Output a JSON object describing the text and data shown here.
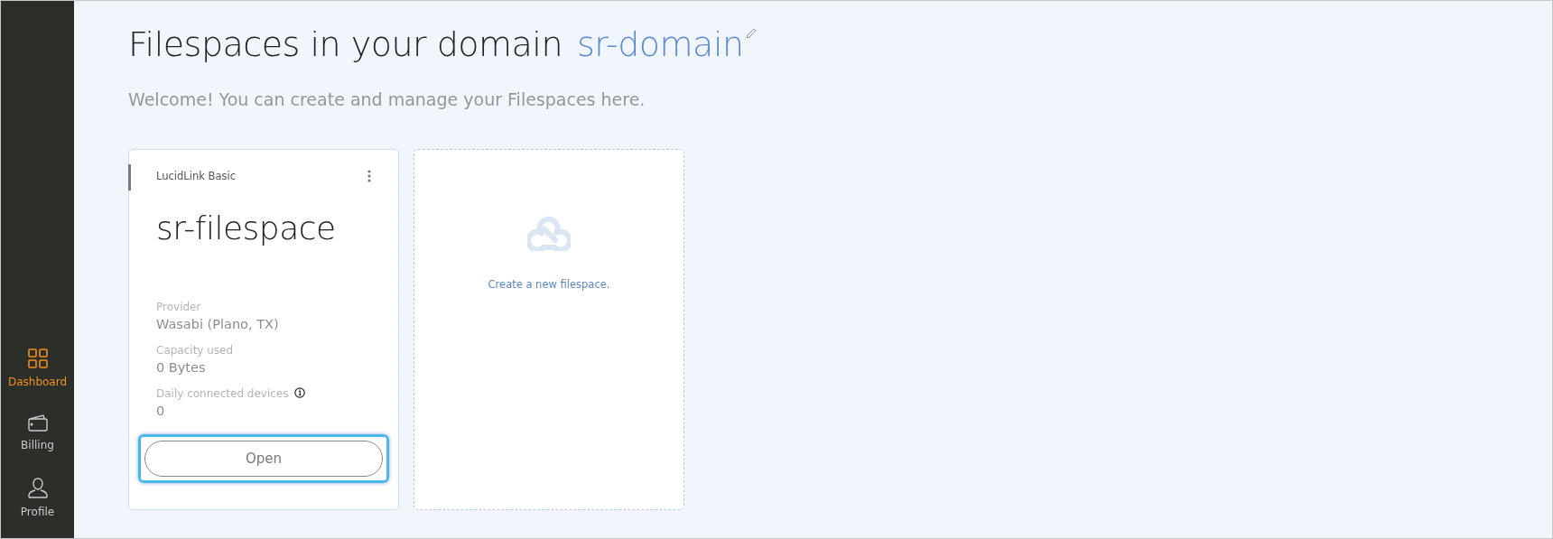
{
  "sidebar": {
    "items": [
      {
        "label": "Dashboard",
        "kind": "grid",
        "selected": true
      },
      {
        "label": "Billing",
        "kind": "wallet",
        "selected": false
      },
      {
        "label": "Profile",
        "kind": "person",
        "selected": false
      }
    ]
  },
  "header": {
    "title": "Filespaces in your domain",
    "domain": "sr-domain",
    "subtitle": "Welcome! You can create and manage your Filespaces here."
  },
  "filespaces": [
    {
      "plan": "LucidLink Basic",
      "name": "sr-filespace",
      "fields": [
        {
          "label": "Provider",
          "value": "Wasabi (Plano, TX)",
          "info": false
        },
        {
          "label": "Capacity used",
          "value": "0 Bytes",
          "info": false
        },
        {
          "label": "Daily connected devices",
          "value": "0",
          "info": true
        }
      ],
      "button": {
        "label": "Open",
        "focused": true
      }
    }
  ],
  "create_card": {
    "label": "Create a new filespace."
  }
}
